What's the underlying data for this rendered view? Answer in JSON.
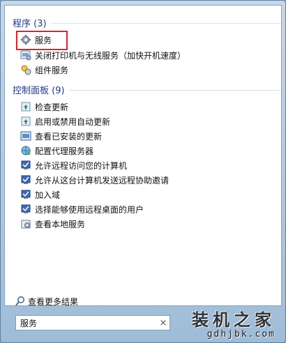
{
  "sections": {
    "programs": {
      "title": "程序 (3)",
      "items": [
        {
          "label": "服务",
          "icon": "gear-icon"
        },
        {
          "label": "关闭打印机与无线服务（加快开机速度）",
          "icon": "printer-service-icon"
        },
        {
          "label": "组件服务",
          "icon": "component-services-icon"
        }
      ]
    },
    "control_panel": {
      "title": "控制面板 (9)",
      "items": [
        {
          "label": "检查更新",
          "icon": "windows-update-icon"
        },
        {
          "label": "启用或禁用自动更新",
          "icon": "windows-update-icon"
        },
        {
          "label": "查看已安装的更新",
          "icon": "installed-updates-icon"
        },
        {
          "label": "配置代理服务器",
          "icon": "proxy-globe-icon"
        },
        {
          "label": "允许远程访问您的计算机",
          "icon": "system-remote-icon"
        },
        {
          "label": "允许从这台计算机发送远程协助邀请",
          "icon": "system-remote-icon"
        },
        {
          "label": "加入域",
          "icon": "system-remote-icon"
        },
        {
          "label": "选择能够使用远程桌面的用户",
          "icon": "system-remote-icon"
        },
        {
          "label": "查看本地服务",
          "icon": "local-services-icon"
        }
      ]
    }
  },
  "more_results": {
    "label": "查看更多结果",
    "icon": "magnifier-icon"
  },
  "search": {
    "value": "服务",
    "clear": "×"
  },
  "watermark": {
    "title": "装机之家",
    "url": "gdhjbk.com"
  },
  "colors": {
    "header": "#1e3b87",
    "highlight": "#d9262a"
  }
}
